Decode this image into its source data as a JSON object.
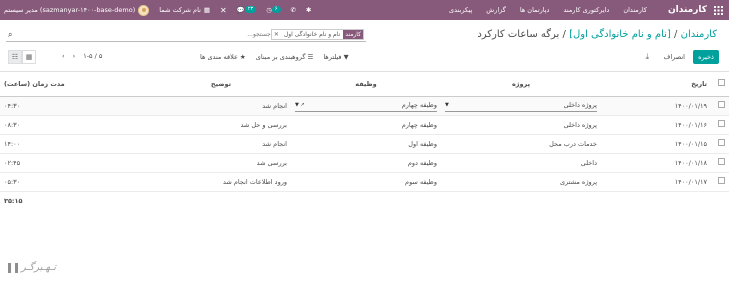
{
  "topbar": {
    "brand": "کارمندان",
    "menu": [
      "کارمندان",
      "دایرکتوری کارمند",
      "دپارتمان ها",
      "گزارش",
      "پیکربندی"
    ],
    "company": "نام شرکت شما",
    "chat_badge": "۲۳",
    "activity_badge": "۶",
    "user": "مدیر سیستم (sazmanyar-۱۴۰۰-base-demo)"
  },
  "breadcrumb": {
    "parent": "کارمندان",
    "record": "[نام و نام خانوادگی اول]",
    "current": "برگه ساعات کارکرد"
  },
  "search": {
    "facet_key": "کارمند",
    "facet_value": "نام و نام خانوادگی اول",
    "placeholder": "جستجو..."
  },
  "buttons": {
    "save": "ذخیره",
    "discard": "انصراف"
  },
  "options": {
    "filters": "فیلترها",
    "group_by": "گروهبندی بر مبنای",
    "favorites": "علاقه مندی ها"
  },
  "pager": {
    "range": "۱-۵ / ۵"
  },
  "table": {
    "headers": {
      "date": "تاریخ",
      "project": "پروژه",
      "task": "وظیفه",
      "description": "توضیح",
      "duration": "مدت زمان (ساعت)"
    },
    "edit_row": {
      "date": "۱۴۰۰/۰۱/۱۹",
      "project": "پروژه داخلی",
      "task": "وظیفه چهارم",
      "description": "انجام شد",
      "duration": "۰۴:۳۰"
    },
    "rows": [
      {
        "date": "۱۴۰۰/۰۱/۱۶",
        "project": "پروژه داخلی",
        "task": "وظیفه چهارم",
        "description": "بررسی و حل شد",
        "duration": "۰۸:۳۰"
      },
      {
        "date": "۱۴۰۰/۰۱/۱۵",
        "project": "خدمات درب محل",
        "task": "وظیفه اول",
        "description": "انجام شد",
        "duration": "۱۴:۰۰"
      },
      {
        "date": "۱۴۰۰/۰۱/۱۸",
        "project": "داخلی",
        "task": "وظیفه دوم",
        "description": "بررسی شد",
        "duration": "۰۲:۴۵"
      },
      {
        "date": "۱۴۰۰/۰۱/۱۷",
        "project": "پروژه مشتری",
        "task": "وظیفه سوم",
        "description": "ورود اطلاعات انجام شد",
        "duration": "۰۵:۳۰"
      }
    ],
    "total": "۳۵:۱۵"
  },
  "watermark": "تـهـبرگـر"
}
